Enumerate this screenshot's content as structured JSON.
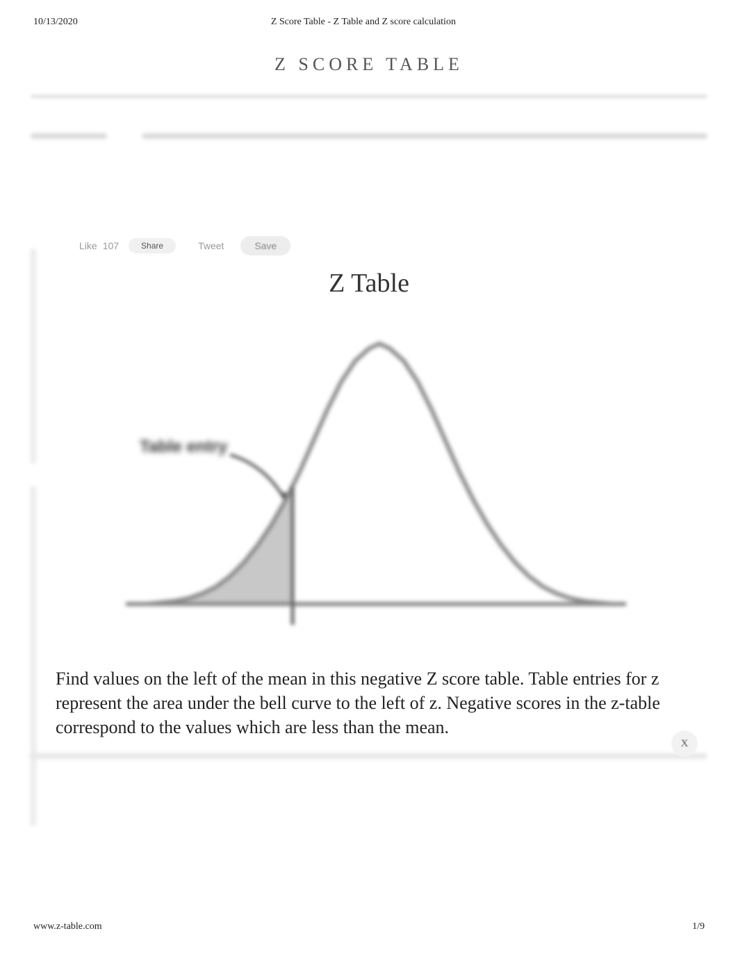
{
  "header": {
    "date": "10/13/2020",
    "doc_title": "Z Score Table - Z Table and Z score calculation"
  },
  "page_title": "Z SCORE TABLE",
  "social": {
    "like_label": "Like",
    "like_count": "107",
    "share_label": "Share",
    "tweet_label": "Tweet",
    "save_label": "Save"
  },
  "section_heading": "Z Table",
  "chart_data": {
    "type": "area",
    "title": "",
    "annotation": "Table entry",
    "x": [
      -3.5,
      -3.0,
      -2.5,
      -2.0,
      -1.5,
      -1.0,
      -0.5,
      0.0,
      0.5,
      1.0,
      1.5,
      2.0,
      2.5,
      3.0,
      3.5
    ],
    "pdf": [
      0.0009,
      0.0044,
      0.0175,
      0.054,
      0.1295,
      0.242,
      0.3521,
      0.3989,
      0.3521,
      0.242,
      0.1295,
      0.054,
      0.0175,
      0.0044,
      0.0009
    ],
    "shaded_to_x": -1.0,
    "xlim": [
      -3.5,
      3.5
    ],
    "ylim": [
      0,
      0.42
    ]
  },
  "description_text": "Find values on the left of the mean in this negative Z score table. Table entries for z represent the area under the bell curve to the left of z. Negative scores in the z-table correspond to the values which are less than the mean.",
  "close_label": "X",
  "footer": {
    "url": "www.z-table.com",
    "page_num": "1/9"
  }
}
